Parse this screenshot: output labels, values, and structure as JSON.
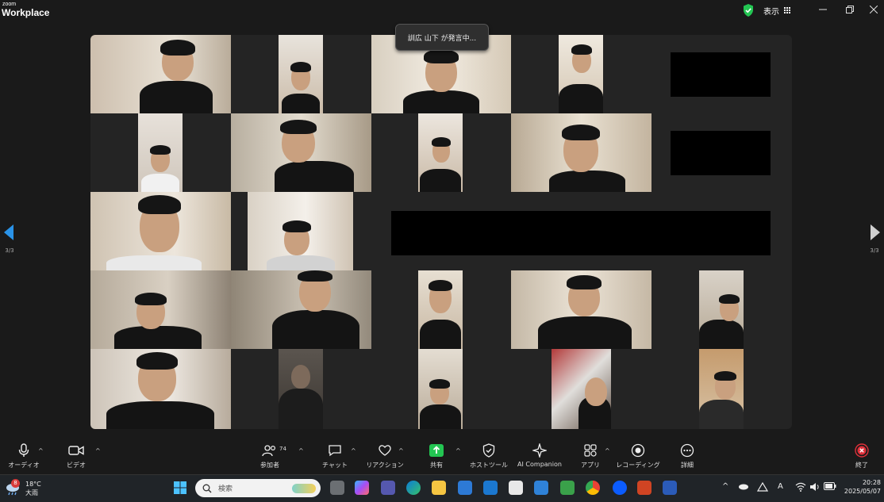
{
  "app": {
    "logo_small": "zoom",
    "logo_big": "Workplace"
  },
  "titlebar": {
    "view_label": "表示"
  },
  "meeting": {
    "speaker_toast": "訓広 山下 が発言中...",
    "page_left": "3/3",
    "page_right": "3/3"
  },
  "toolbar": {
    "audio": "オーディオ",
    "video": "ビデオ",
    "participants": "参加者",
    "participants_count": "74",
    "chat": "チャット",
    "reactions": "リアクション",
    "share": "共有",
    "host_tools": "ホストツール",
    "ai_companion": "AI Companion",
    "apps": "アプリ",
    "recording": "レコーディング",
    "more": "詳細",
    "end": "終了"
  },
  "taskbar": {
    "weather_badge": "8",
    "temperature": "18°C",
    "weather_text": "大雨",
    "search_placeholder": "検索",
    "ime_label": "A",
    "time": "20:28",
    "date": "2025/05/07"
  },
  "colors": {
    "accent_green": "#23c552",
    "end_red": "#e0303a",
    "zoom_blue": "#0b5cff"
  }
}
